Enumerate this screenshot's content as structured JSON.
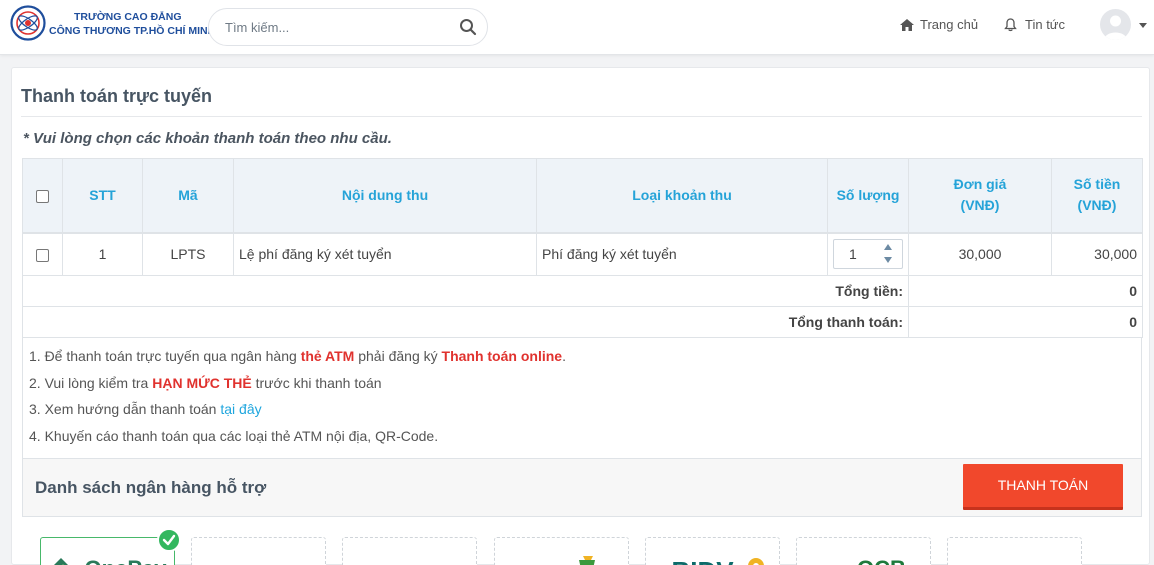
{
  "header": {
    "school_line1": "TRƯỜNG CAO ĐẲNG",
    "school_line2": "CÔNG THƯƠNG TP.HỒ CHÍ MINH",
    "search_placeholder": "Tìm kiếm...",
    "nav_home": "Trang chủ",
    "nav_news": "Tin tức"
  },
  "page": {
    "title": "Thanh toán trực tuyến",
    "note": "* Vui lòng chọn các khoản thanh toán theo nhu cầu."
  },
  "table": {
    "headers": {
      "stt": "STT",
      "ma": "Mã",
      "noi_dung": "Nội dung thu",
      "loai": "Loại khoản thu",
      "so_luong": "Số lượng",
      "don_gia_l1": "Đơn giá",
      "don_gia_l2": "(VNĐ)",
      "so_tien_l1": "Số tiền",
      "so_tien_l2": "(VNĐ)"
    },
    "rows": [
      {
        "stt": "1",
        "ma": "LPTS",
        "noi_dung": "Lệ phí đăng ký xét tuyển",
        "loai": "Phí đăng ký xét tuyển",
        "so_luong": "1",
        "don_gia": "30,000",
        "so_tien": "30,000"
      }
    ],
    "tong_tien_label": "Tổng tiền:",
    "tong_tien_value": "0",
    "tong_thanh_toan_label": "Tổng thanh toán:",
    "tong_thanh_toan_value": "0"
  },
  "instructions": {
    "i1_pre": "1. Để thanh toán trực tuyến qua ngân hàng ",
    "i1_red1": "thẻ ATM",
    "i1_mid": " phải đăng ký ",
    "i1_red2": "Thanh toán online",
    "i1_post": ".",
    "i2_pre": "2. Vui lòng kiểm tra ",
    "i2_red": "HẠN MỨC THẺ",
    "i2_post": " trước khi thanh toán",
    "i3_pre": "3. Xem hướng dẫn thanh toán ",
    "i3_link": "tại đây",
    "i4": "4. Khuyến cáo thanh toán qua các loại thẻ ATM nội địa, QR-Code."
  },
  "banks": {
    "title": "Danh sách ngân hàng hỗ trợ",
    "pay_button": "THANH TOÁN",
    "items": [
      {
        "name": "OnePay",
        "visible_text": "OnePay",
        "color": "#2a7a5a",
        "selected": true
      },
      {
        "name": "bank-2",
        "visible_text": "",
        "color": "#888888",
        "selected": false
      },
      {
        "name": "bank-3",
        "visible_text": "",
        "color": "#1d5f6e",
        "selected": false
      },
      {
        "name": "bank-4",
        "visible_text": "",
        "color": "#3b9a3d",
        "selected": false
      },
      {
        "name": "BIDV",
        "visible_text": "BIDV",
        "color": "#0d6b6a",
        "selected": false
      },
      {
        "name": "OCB",
        "visible_text": "OCB",
        "color": "#e2822b",
        "selected": false
      },
      {
        "name": "bank-7",
        "visible_text": "",
        "color": "#888888",
        "selected": false
      }
    ]
  },
  "colors": {
    "accent_blue": "#25a3d8",
    "pay_button": "#f1482c",
    "alert_red": "#e0322e",
    "selected_green": "#33b75f"
  }
}
